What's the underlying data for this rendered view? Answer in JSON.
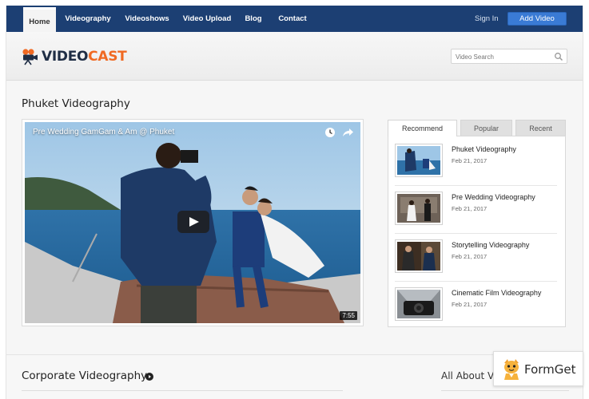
{
  "nav": {
    "items": [
      {
        "label": "Home",
        "active": true
      },
      {
        "label": "Videography",
        "active": false
      },
      {
        "label": "Videoshows",
        "active": false
      },
      {
        "label": "Video Upload",
        "active": false
      },
      {
        "label": "Blog",
        "active": false
      },
      {
        "label": "Contact",
        "active": false
      }
    ],
    "sign_in": "Sign In",
    "add_video": "Add Video",
    "colors": {
      "bar": "#1c3f73",
      "button": "#3a7bd5"
    }
  },
  "header": {
    "logo": {
      "part1": "VIDEO",
      "part2": "CAST",
      "icon": "video-camera-icon",
      "accent": "#f06a23"
    },
    "search": {
      "placeholder": "Video Search",
      "value": "",
      "icon": "search-icon"
    }
  },
  "main": {
    "title": "Phuket Videography",
    "player": {
      "title": "Pre Wedding GamGam & Am @ Phuket",
      "duration": "7:55",
      "icons": [
        "clock-icon",
        "share-icon",
        "play-icon"
      ]
    }
  },
  "sidebar": {
    "tabs": [
      {
        "label": "Recommend",
        "active": true
      },
      {
        "label": "Popular",
        "active": false
      },
      {
        "label": "Recent",
        "active": false
      }
    ],
    "videos": [
      {
        "title": "Phuket Videography",
        "date": "Feb 21, 2017"
      },
      {
        "title": "Pre Wedding Videography",
        "date": "Feb 21, 2017"
      },
      {
        "title": "Storytelling Videography",
        "date": "Feb 21, 2017"
      },
      {
        "title": "Cinematic Film Videography",
        "date": "Feb 21, 2017"
      }
    ]
  },
  "bottom": {
    "section_title": "Corporate Videography",
    "right_title": "All About Vid"
  },
  "badge": {
    "text": "FormGet",
    "icon": "formget-mascot-icon"
  }
}
